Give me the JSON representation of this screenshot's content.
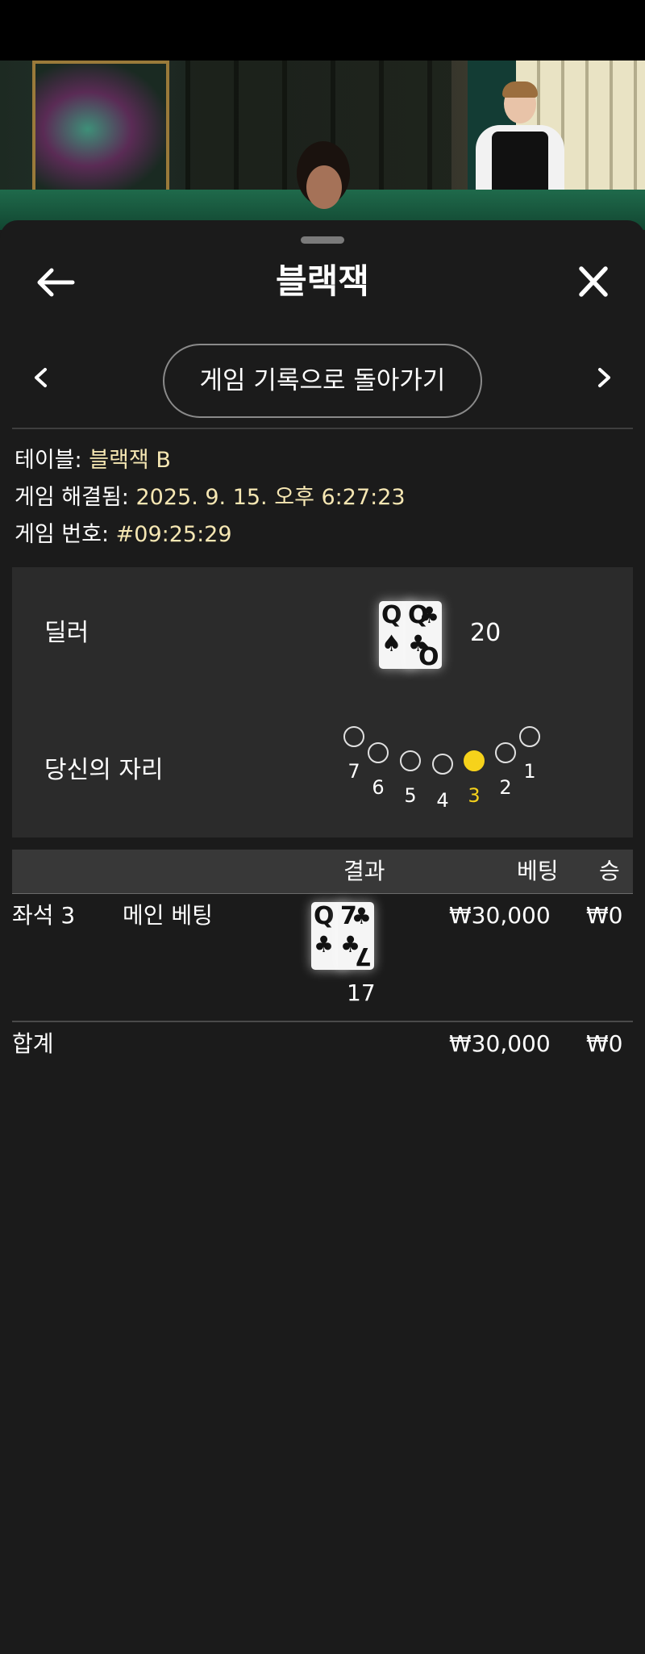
{
  "header": {
    "title": "블랙잭"
  },
  "navigation": {
    "back_to_history": "게임 기록으로 돌아가기"
  },
  "info": {
    "table_label": "테이블:",
    "table_value": "블랙잭 B",
    "resolved_label": "게임 해결됨:",
    "resolved_value": "2025. 9. 15. 오후 6:27:23",
    "game_no_label": "게임 번호:",
    "game_no_value": "#09:25:29"
  },
  "dealer": {
    "label": "딜러",
    "cards": [
      {
        "rank": "Q",
        "suit": "♠"
      },
      {
        "rank": "Q",
        "suit": "♣"
      }
    ],
    "score": "20"
  },
  "seats": {
    "label": "당신의 자리",
    "numbers": [
      "7",
      "6",
      "5",
      "4",
      "3",
      "2",
      "1"
    ],
    "active": "3"
  },
  "results_table": {
    "headers": {
      "result": "결과",
      "bet": "베팅",
      "win": "승"
    },
    "rows": [
      {
        "seat": "좌석 3",
        "bet_type": "메인 베팅",
        "cards": [
          {
            "rank": "Q",
            "suit": "♣"
          },
          {
            "rank": "7",
            "suit": "♣"
          }
        ],
        "score": "17",
        "bet": "₩30,000",
        "win": "₩0"
      }
    ],
    "total": {
      "label": "합계",
      "bet": "₩30,000",
      "win": "₩0"
    }
  },
  "colors": {
    "background": "#1b1b1b",
    "panel": "#2b2b2b",
    "table_header": "#383838",
    "accent_value": "#f6e7b3",
    "active_seat": "#f6d21b"
  },
  "icons": {
    "back": "arrow-left-icon",
    "close": "close-icon",
    "prev": "chevron-left-icon",
    "next": "chevron-right-icon"
  }
}
